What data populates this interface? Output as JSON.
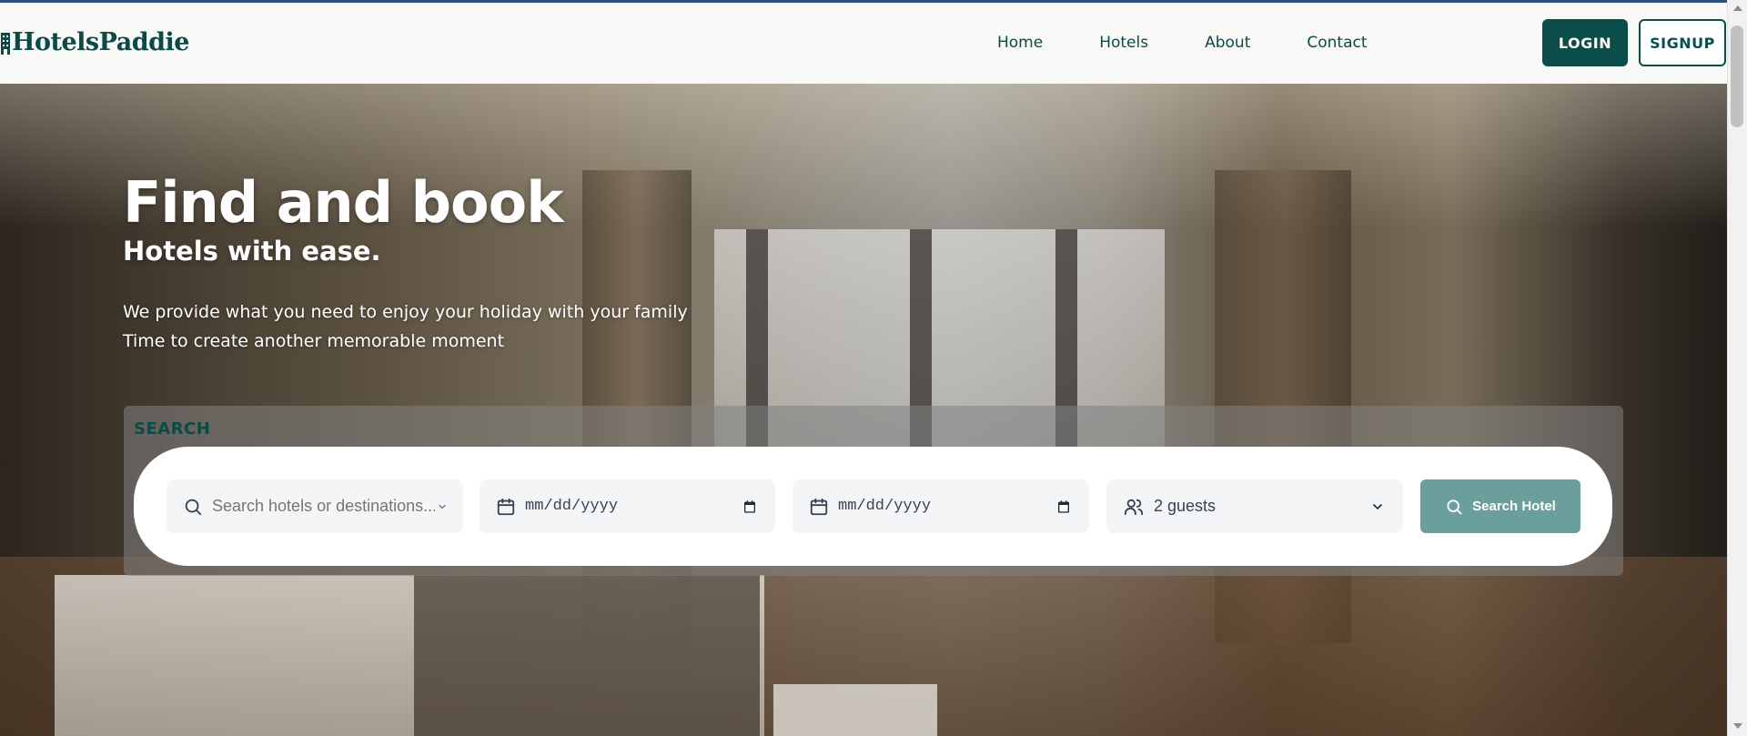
{
  "brand": {
    "name": "HotelsPaddie",
    "primary_color": "#0a4d4a"
  },
  "nav": {
    "items": [
      {
        "label": "Home"
      },
      {
        "label": "Hotels"
      },
      {
        "label": "About"
      },
      {
        "label": "Contact"
      }
    ],
    "login_label": "LOGIN",
    "signup_label": "SIGNUP"
  },
  "hero": {
    "title": "Find and book",
    "subtitle": "Hotels with ease.",
    "line1": "We provide what you need to enjoy your holiday with your family",
    "line2": "Time to create another memorable moment"
  },
  "search": {
    "section_label": "SEARCH",
    "destination_placeholder": "Search hotels or destinations...",
    "checkin_value": "mm/dd/yyyy",
    "checkout_value": "mm/dd/yyyy",
    "guests_value": "2 guests",
    "button_label": "Search Hotel",
    "button_color": "#6b9f9c"
  },
  "icons": {
    "search": "search-icon",
    "calendar": "calendar-icon",
    "guests": "users-icon",
    "chevron": "chevron-down-icon"
  }
}
